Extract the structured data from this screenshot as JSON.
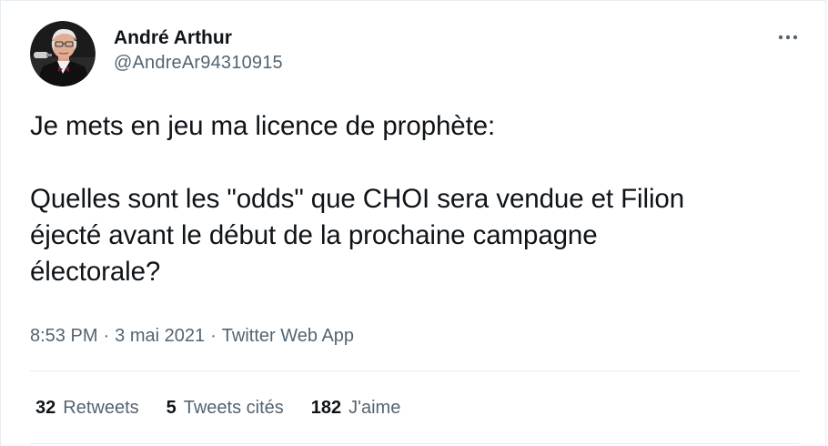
{
  "author": {
    "display_name": "André Arthur",
    "handle": "@AndreAr94310915",
    "avatar_icon": "profile-photo"
  },
  "tweet": {
    "text": "Je mets en jeu ma licence de prophète:\n\nQuelles sont les \"odds\" que CHOI sera vendue et Filion\néjecté avant le début de la prochaine campagne\nélectorale?",
    "time": "8:53 PM",
    "separator": "·",
    "date": "3 mai 2021",
    "source": "Twitter Web App"
  },
  "stats": {
    "retweets_count": "32",
    "retweets_label": "Retweets",
    "quotes_count": "5",
    "quotes_label": "Tweets cités",
    "likes_count": "182",
    "likes_label": "J'aime"
  },
  "icons": {
    "more": "more-horizontal-icon"
  },
  "colors": {
    "text_primary": "#0f1419",
    "text_secondary": "#536471",
    "divider": "#e6ecf0"
  }
}
